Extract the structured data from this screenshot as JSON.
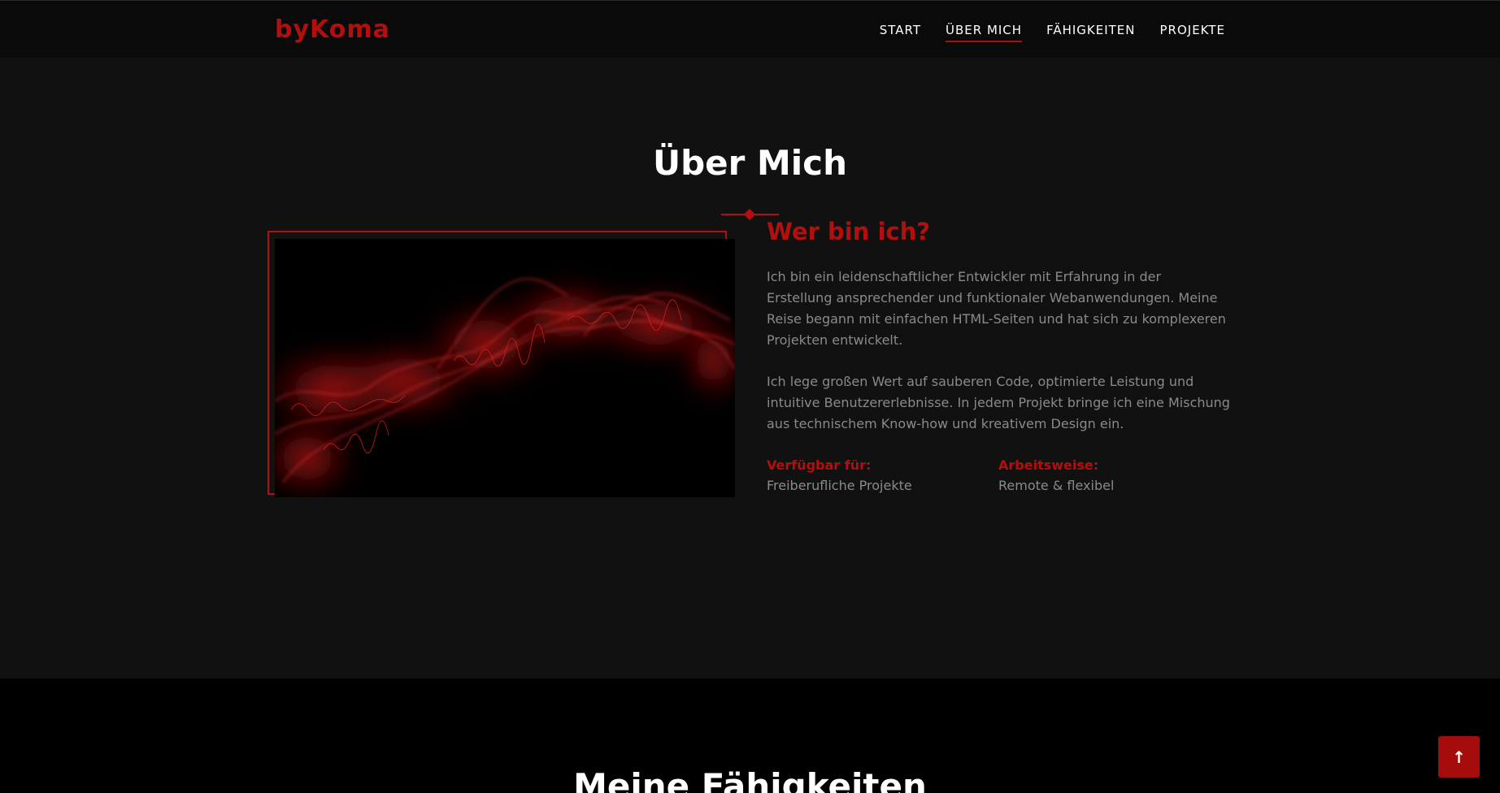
{
  "header": {
    "logo": "byKoma",
    "nav": [
      {
        "label": "START"
      },
      {
        "label": "ÜBER MICH",
        "active": true
      },
      {
        "label": "FÄHIGKEITEN"
      },
      {
        "label": "PROJEKTE"
      }
    ]
  },
  "about": {
    "title": "Über Mich",
    "heading": "Wer bin ich?",
    "paragraphs": [
      "Ich bin ein leidenschaftlicher Entwickler mit Erfahrung in der Erstellung ansprechender und funktionaler Webanwendungen. Meine Reise begann mit einfachen HTML-Seiten und hat sich zu komplexeren Projekten entwickelt.",
      "Ich lege großen Wert auf sauberen Code, optimierte Leistung und intuitive Benutzererlebnisse. In jedem Projekt bringe ich eine Mischung aus technischem Know-how und kreativem Design ein."
    ],
    "info": [
      {
        "label": "Verfügbar für:",
        "value": "Freiberufliche Projekte"
      },
      {
        "label": "Arbeitsweise:",
        "value": "Remote & flexibel"
      }
    ]
  },
  "skills": {
    "title": "Meine Fähigkeiten"
  },
  "back_to_top": {
    "icon": "arrow-up-icon",
    "glyph": "↑"
  },
  "colors": {
    "accent": "#b30f0f",
    "background": "#111111",
    "header_bg": "#0a0a0a",
    "body_text": "#8a8a8a"
  }
}
